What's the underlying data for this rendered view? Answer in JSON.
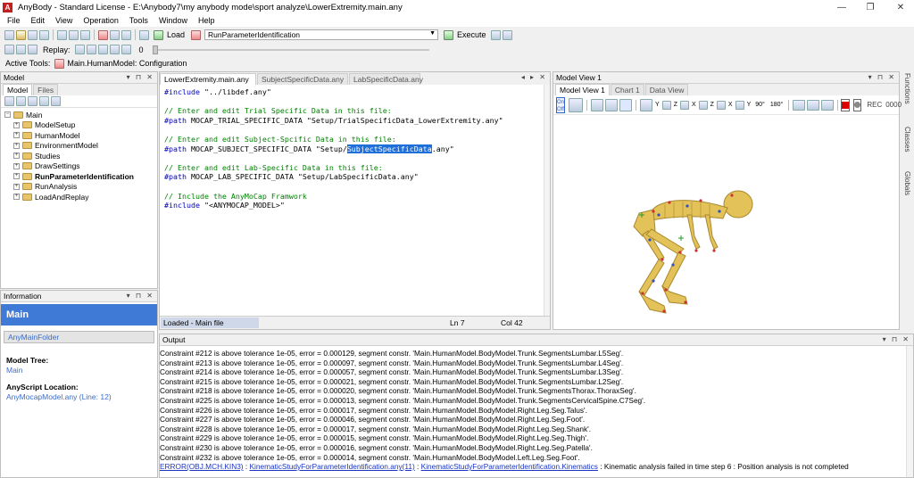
{
  "window": {
    "app": "AnyBody",
    "title": "AnyBody  -  Standard License  -  E:\\Anybody7\\my anybody mode\\sport analyze\\LowerExtremity.main.any",
    "controls": [
      "—",
      "❐",
      "✕"
    ]
  },
  "menu": [
    "File",
    "Edit",
    "View",
    "Operation",
    "Tools",
    "Window",
    "Help"
  ],
  "toolbar": {
    "load_label": "Load",
    "operation_value": "RunParameterIdentification",
    "execute_label": "Execute",
    "replay_label": "Replay:",
    "replay_value": "0",
    "active_tools_label": "Active Tools:",
    "active_tools_value": "Main.HumanModel: Configuration"
  },
  "model_panel": {
    "header": "Model",
    "tabs": [
      "Model",
      "Files"
    ],
    "tree": [
      {
        "label": "Main",
        "bold": false,
        "level": 0
      },
      {
        "label": "ModelSetup",
        "bold": false,
        "level": 1
      },
      {
        "label": "HumanModel",
        "bold": false,
        "level": 1
      },
      {
        "label": "EnvironmentModel",
        "bold": false,
        "level": 1
      },
      {
        "label": "Studies",
        "bold": false,
        "level": 1
      },
      {
        "label": "DrawSettings",
        "bold": false,
        "level": 1
      },
      {
        "label": "RunParameterIdentification",
        "bold": true,
        "level": 1
      },
      {
        "label": "RunAnalysis",
        "bold": false,
        "level": 1
      },
      {
        "label": "LoadAndReplay",
        "bold": false,
        "level": 1
      }
    ]
  },
  "info_panel": {
    "header": "Information",
    "title": "Main",
    "folder_button": "AnyMainFolder",
    "tree_label": "Model Tree:",
    "tree_value": "Main",
    "location_label": "AnyScript Location:",
    "location_value": "AnyMocapModel.any (Line: 12)"
  },
  "editor": {
    "tabs": [
      "LowerExtremity.main.any",
      "SubjectSpecificData.any",
      "LabSpecificData.any"
    ],
    "lines": [
      {
        "kw": "#include",
        "rest": " \"../libdef.any\""
      },
      {
        "blank": true
      },
      {
        "cmt": "// Enter and edit Trial Specific Data in this file:"
      },
      {
        "kw": "#path",
        "rest": " MOCAP_TRIAL_SPECIFIC_DATA \"Setup/TrialSpecificData_LowerExtremity.any\""
      },
      {
        "blank": true
      },
      {
        "cmt": "// Enter and edit Subject-Spcific Data in this file:"
      },
      {
        "kw": "#path",
        "rest": " MOCAP_SUBJECT_SPECIFIC_DATA \"Setup/",
        "hl": "SubjectSpecificData",
        "after": ".any\""
      },
      {
        "blank": true
      },
      {
        "cmt": "// Enter and edit Lab-Specific Data in this file:"
      },
      {
        "kw": "#path",
        "rest": " MOCAP_LAB_SPECIFIC_DATA \"Setup/LabSpecificData.any\""
      },
      {
        "blank": true
      },
      {
        "cmt": "// Include the AnyMoCap Framwork"
      },
      {
        "kw": "#include",
        "rest": " \"<ANYMOCAP_MODEL>\""
      }
    ],
    "status_left": "Loaded - Main file",
    "status_line": "Ln 7",
    "status_col": "Col 42"
  },
  "model_view": {
    "header": "Model View 1",
    "tabs": [
      "Model View 1",
      "Chart 1",
      "Data View"
    ],
    "onoff_label": "On Off",
    "rec_label": "REC",
    "rec_value": "0000",
    "view_labels": [
      "Y",
      "Z",
      "X",
      "Z",
      "X",
      "Y",
      "90°",
      "180°"
    ]
  },
  "side_tabs": [
    "Functions",
    "Classes",
    "Globals"
  ],
  "output": {
    "header": "Output",
    "lines": [
      "Constraint #212 is above tolerance 1e-05, error = 0.000129, segment constr. 'Main.HumanModel.BodyModel.Trunk.SegmentsLumbar.L5Seg'.",
      "Constraint #213 is above tolerance 1e-05, error = 0.000097, segment constr. 'Main.HumanModel.BodyModel.Trunk.SegmentsLumbar.L4Seg'.",
      "Constraint #214 is above tolerance 1e-05, error = 0.000057, segment constr. 'Main.HumanModel.BodyModel.Trunk.SegmentsLumbar.L3Seg'.",
      "Constraint #215 is above tolerance 1e-05, error = 0.000021, segment constr. 'Main.HumanModel.BodyModel.Trunk.SegmentsLumbar.L2Seg'.",
      "Constraint #218 is above tolerance 1e-05, error = 0.000020, segment constr. 'Main.HumanModel.BodyModel.Trunk.SegmentsThorax.ThoraxSeg'.",
      "Constraint #225 is above tolerance 1e-05, error = 0.000013, segment constr. 'Main.HumanModel.BodyModel.Trunk.SegmentsCervicalSpine.C7Seg'.",
      "Constraint #226 is above tolerance 1e-05, error = 0.000017, segment constr. 'Main.HumanModel.BodyModel.Right.Leg.Seg.Talus'.",
      "Constraint #227 is above tolerance 1e-05, error = 0.000046, segment constr. 'Main.HumanModel.BodyModel.Right.Leg.Seg.Foot'.",
      "Constraint #228 is above tolerance 1e-05, error = 0.000017, segment constr. 'Main.HumanModel.BodyModel.Right.Leg.Seg.Shank'.",
      "Constraint #229 is above tolerance 1e-05, error = 0.000015, segment constr. 'Main.HumanModel.BodyModel.Right.Leg.Seg.Thigh'.",
      "Constraint #230 is above tolerance 1e-05, error = 0.000016, segment constr. 'Main.HumanModel.BodyModel.Right.Leg.Seg.Patella'.",
      "Constraint #232 is above tolerance 1e-05, error = 0.000014, segment constr. 'Main.HumanModel.BodyModel.Left.Leg.Seg.Foot'."
    ],
    "error_code": "ERROR(OBJ.MCH.KIN3)",
    "error_sep1": " :  ",
    "error_file": "KinematicStudyForParameterIdentification.any(11)",
    "error_sep2": " :  ",
    "error_obj": "KinematicStudyForParameterIdentification.Kinematics",
    "error_msg": "  :  Kinematic analysis failed in time step 6 : Position analysis is not completed"
  }
}
